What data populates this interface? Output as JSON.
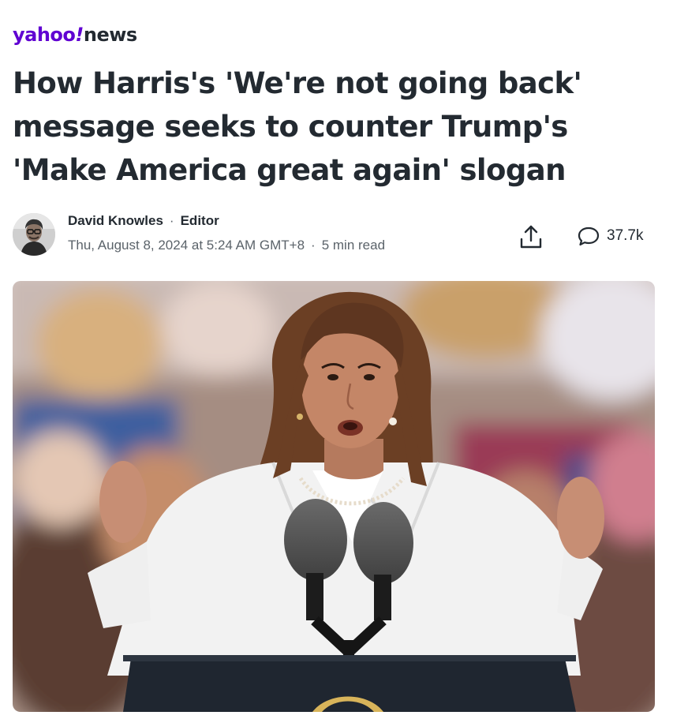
{
  "brand": {
    "yahoo": "yahoo",
    "bang": "!",
    "section": "news"
  },
  "article": {
    "headline": "How Harris's 'We're not going back' message seeks to counter Trump's 'Make America great again' slogan",
    "author": {
      "name": "David Knowles",
      "separator": "·",
      "role": "Editor",
      "date": "Thu, August 8, 2024 at 5:24 AM GMT+8",
      "read_time": "5 min read"
    },
    "comments_count": "37.7k"
  },
  "icons": {
    "share": "share-icon",
    "comment": "comment-bubble-icon"
  },
  "colors": {
    "brand_purple": "#6001d2",
    "headline": "#232a31",
    "meta": "#5b636a"
  }
}
